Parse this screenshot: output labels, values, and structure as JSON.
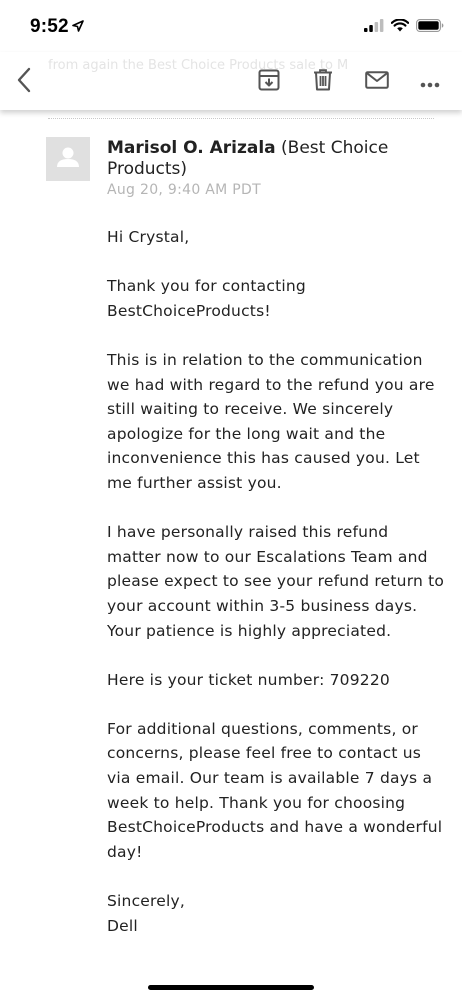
{
  "status_bar": {
    "time": "9:52",
    "icons": [
      "location-arrow-icon",
      "signal-icon",
      "wifi-icon",
      "battery-icon"
    ]
  },
  "toolbar": {
    "background_text": "from again the Best Choice Products sale to M",
    "actions": [
      "back-icon",
      "archive-icon",
      "trash-icon",
      "mail-icon",
      "more-icon"
    ]
  },
  "email": {
    "sender_name": "Marisol O. Arizala",
    "sender_org": "(Best Choice Products)",
    "date": "Aug 20, 9:40 AM PDT",
    "greeting": "Hi Crystal,",
    "paragraphs": [
      "Thank you for contacting BestChoiceProducts!",
      "This is in relation to the communication we had with regard to the refund you are still waiting to receive. We sincerely apologize for the long wait and the inconvenience this has caused you. Let me further assist you.",
      "I have personally raised this refund matter now to our Escalations Team and  please expect to see your refund return to your account within 3-5 business days. Your patience is highly appreciated.",
      "Here is your ticket number: 709220",
      "For additional questions, comments, or concerns, please feel free to contact us via email. Our team is available 7 days a week to help. Thank you for choosing BestChoiceProducts and have a wonderful day!"
    ],
    "closing": "Sincerely,",
    "signature": "Dell"
  },
  "colors": {
    "icon_gray": "#555555",
    "date_gray": "#b5b5b5",
    "avatar_bg": "#e0e0e0"
  }
}
